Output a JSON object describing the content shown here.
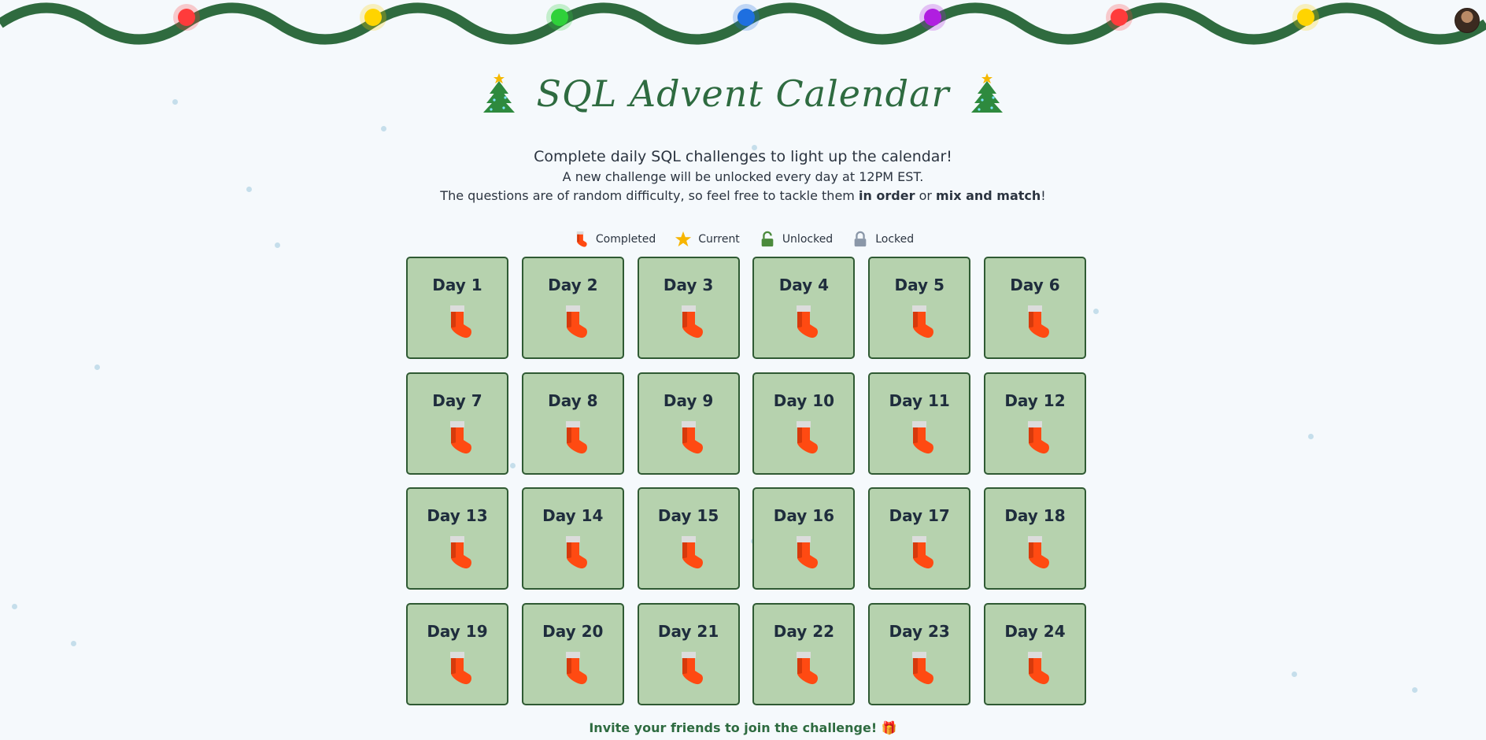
{
  "page": {
    "title": "SQL Advent Calendar",
    "subtitle": "Complete daily SQL challenges to light up the calendar!",
    "unlock_note": "A new challenge will be unlocked every day at 12PM EST.",
    "difficulty_prefix": "The questions are of random difficulty, so feel free to tackle them ",
    "difficulty_bold_1": "in order",
    "difficulty_mid": " or ",
    "difficulty_bold_2": "mix and match",
    "difficulty_suffix": "!",
    "invite": "Invite your friends to join the challenge! 🎁"
  },
  "legend": {
    "completed": "Completed",
    "current": "Current",
    "unlocked": "Unlocked",
    "locked": "Locked"
  },
  "days": [
    {
      "label": "Day 1",
      "status": "completed"
    },
    {
      "label": "Day 2",
      "status": "completed"
    },
    {
      "label": "Day 3",
      "status": "completed"
    },
    {
      "label": "Day 4",
      "status": "completed"
    },
    {
      "label": "Day 5",
      "status": "completed"
    },
    {
      "label": "Day 6",
      "status": "completed"
    },
    {
      "label": "Day 7",
      "status": "completed"
    },
    {
      "label": "Day 8",
      "status": "completed"
    },
    {
      "label": "Day 9",
      "status": "completed"
    },
    {
      "label": "Day 10",
      "status": "completed"
    },
    {
      "label": "Day 11",
      "status": "completed"
    },
    {
      "label": "Day 12",
      "status": "completed"
    },
    {
      "label": "Day 13",
      "status": "completed"
    },
    {
      "label": "Day 14",
      "status": "completed"
    },
    {
      "label": "Day 15",
      "status": "completed"
    },
    {
      "label": "Day 16",
      "status": "completed"
    },
    {
      "label": "Day 17",
      "status": "completed"
    },
    {
      "label": "Day 18",
      "status": "completed"
    },
    {
      "label": "Day 19",
      "status": "completed"
    },
    {
      "label": "Day 20",
      "status": "completed"
    },
    {
      "label": "Day 21",
      "status": "completed"
    },
    {
      "label": "Day 22",
      "status": "completed"
    },
    {
      "label": "Day 23",
      "status": "completed"
    },
    {
      "label": "Day 24",
      "status": "completed"
    }
  ],
  "colors": {
    "garland": "#2f6b3f",
    "card_bg": "#b6d2ae",
    "card_border": "#2f5a33",
    "title": "#2e6b40",
    "bulbs": [
      "#ff3b3b",
      "#ffd400",
      "#2fd13a",
      "#1e6fe0",
      "#b01ee0",
      "#ff3b3b",
      "#ffd400"
    ]
  }
}
